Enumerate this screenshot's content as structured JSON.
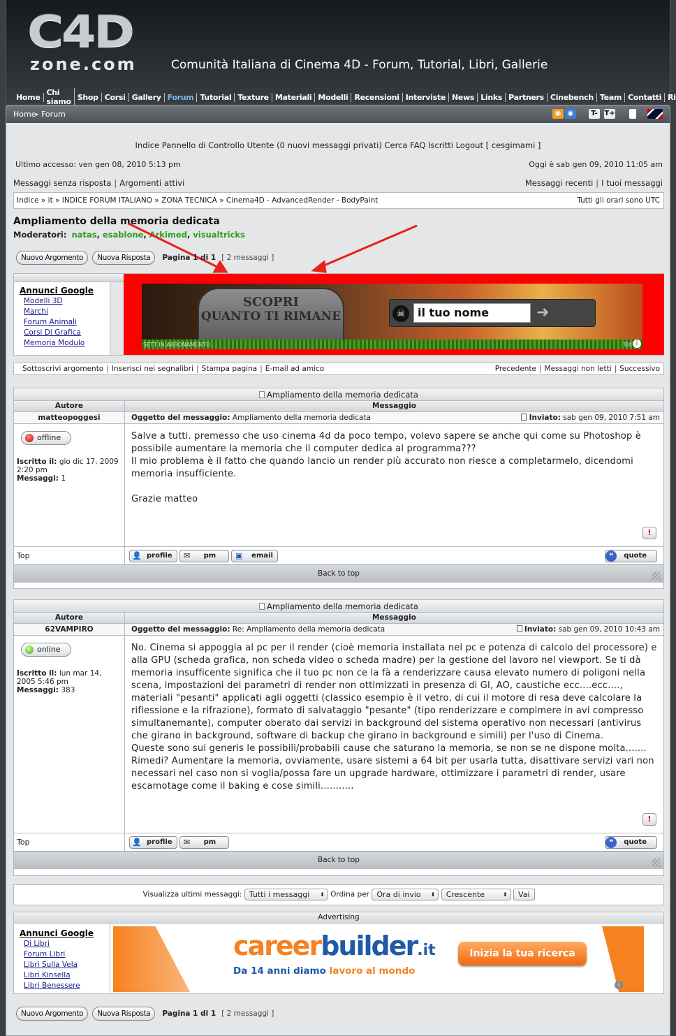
{
  "header": {
    "logo_main": "C4D",
    "logo_sub": "zone.com",
    "tagline": "Comunità Italiana di Cinema 4D - Forum, Tutorial, Libri, Gallerie",
    "nav": [
      "Home",
      "Chi siamo",
      "Shop",
      "Corsi",
      "Gallery",
      "Forum",
      "Tutorial",
      "Texture",
      "Materiali",
      "Modelli",
      "Recensioni",
      "Interviste",
      "News",
      "Links",
      "Partners",
      "Cinebench",
      "Team",
      "Contatti",
      "Ricerca"
    ],
    "active_nav": "Forum"
  },
  "crumb_bar": {
    "home": "Home",
    "forum": "Forum"
  },
  "top_links": [
    "Indice",
    "Pannello di Controllo Utente (0 nuovi messaggi privati)",
    "Cerca",
    "FAQ",
    "Iscritti",
    "Logout [ cesgimami ]"
  ],
  "last_visit": "Ultimo accesso: ven gen 08, 2010 5:13 pm",
  "today": "Oggi è sab gen 09, 2010 11:05 am",
  "search_links": {
    "unanswered": "Messaggi senza risposta",
    "active": "Argomenti attivi",
    "recent": "Messaggi recenti",
    "yours": "I tuoi messaggi"
  },
  "breadcrumb": "Indice » it » INDICE FORUM ITALIANO » ZONA TECNICA » Cinema4D - AdvancedRender - BodyPaint",
  "timezone": "Tutti gli orari sono UTC",
  "topic_title": "Ampliamento della memoria dedicata",
  "moderators_label": "Moderatori:",
  "moderators": [
    "natas",
    "esablone",
    "Arkimed",
    "visualtricks"
  ],
  "buttons": {
    "new_topic": "Nuovo Argomento",
    "reply": "Nuova Risposta"
  },
  "pagination": {
    "text": "Pagina 1 di 1",
    "count": "[ 2 messaggi ]"
  },
  "ad_top": {
    "side_title": "Annunci Google",
    "side_links": [
      "Modelli 3D",
      "Marchi",
      "Forum Animali",
      "Corsi Di Grafica",
      "Memoria Modulo"
    ],
    "banner_text_1": "SCOPRI",
    "banner_text_2": "QUANTO TI RIMANE",
    "banner_input": "il tuo nome",
    "banner_foot": "SETT IN ABBONAMENTO",
    "banner_corner": "Tot"
  },
  "topic_tools": {
    "left": [
      "Sottoscrivi argomento",
      "Inserisci nei segnalibri",
      "Stampa pagina",
      "E-mail ad amico"
    ],
    "right": [
      "Precedente",
      "Messaggi non letti",
      "Successivo"
    ]
  },
  "col_author": "Autore",
  "col_message": "Messaggio",
  "subject_label": "Oggetto del messaggio:",
  "sent_label": "Inviato:",
  "joined_label": "Iscritto il:",
  "posts_label": "Messaggi:",
  "top_label": "Top",
  "back_to_top": "Back to top",
  "posts": [
    {
      "title": "Ampliamento della memoria dedicata",
      "author": "matteopoggesi",
      "subject": "Ampliamento della memoria dedicata",
      "sent": "sab gen 09, 2010 7:51 am",
      "status": "offline",
      "joined": "gio dic 17, 2009 2:20 pm",
      "count": "1",
      "body": [
        "Salve a tutti. premesso che uso cinema 4d da poco tempo, volevo sapere se anche qui come su Photoshop è possibile aumentare la memoria che il computer dedica al programma???",
        "Il mio problema è il fatto che quando lancio un render più accurato non riesce a completarmelo, dicendomi memoria insufficiente.",
        "",
        "Grazie matteo"
      ],
      "actions": [
        "profile",
        "pm",
        "email"
      ],
      "quote": "quote"
    },
    {
      "title": "Ampliamento della memoria dedicata",
      "author": "62VAMPIRO",
      "subject": "Re: Ampliamento della memoria dedicata",
      "sent": "sab gen 09, 2010 10:43 am",
      "status": "online",
      "joined": "lun mar 14, 2005 5:46 pm",
      "count": "383",
      "body": [
        "No. Cinema si appoggia al pc per il render (cioè memoria installata nel pc e potenza di calcolo del processore) e alla GPU (scheda grafica, non scheda video o scheda madre) per la gestione del lavoro nel viewport. Se ti dà memoria insufficente significa che il tuo pc non ce la fà a renderizzare causa elevato numero di poligoni nella scena, impostazioni dei parametri di render non ottimizzati in presenza di GI, AO, caustiche ecc....ecc...., materiali \"pesanti\" applicati agli oggetti (classico esempio è il vetro, di cui il motore di resa deve calcolare la riflessione e la rifrazione), formato di salvataggio \"pesante\" (tipo renderizzare e compimere in avi compresso simultanemante), computer oberato dai servizi in background del sistema operativo non necessari (antivirus che girano in background, software di backup che girano in background e simili) per l'uso di Cinema.",
        "Queste sono sui generis le possibili/probabili cause che saturano la memoria, se non se ne dispone molta.......",
        "Rimedi? Aumentare la memoria, ovviamente, usare sistemi a 64 bit per usarla tutta, disattivare servizi vari non necessari nel caso non si voglia/possa fare un upgrade hardware, ottimizzare i parametri di render, usare escamotage come il baking e cose simili..........."
      ],
      "actions": [
        "profile",
        "pm"
      ],
      "quote": "quote"
    }
  ],
  "display_bar": {
    "label": "Visualizza ultimi messaggi:",
    "messages": "Tutti i messaggi",
    "order_label": "Ordina per",
    "order": "Ora di invio",
    "direction": "Crescente",
    "go": "Vai"
  },
  "ad_bottom": {
    "header": "Advertising",
    "side_title": "Annunci Google",
    "side_links": [
      "Di Libri",
      "Forum Libri",
      "Libri Sulla Vela",
      "Libri Kinsella",
      "Libri Benessere"
    ],
    "brand_1": "career",
    "brand_2": "builder",
    "brand_3": ".it",
    "slogan_1": "Da 14 anni diamo",
    "slogan_2": "lavoro al mondo",
    "cta": "Inizia la tua ricerca"
  },
  "colors": {
    "ad_highlight": "#ff0000",
    "moderator": "#2e9d1e",
    "arrow": "#e8211b",
    "link_blue": "#1a1a8a"
  }
}
